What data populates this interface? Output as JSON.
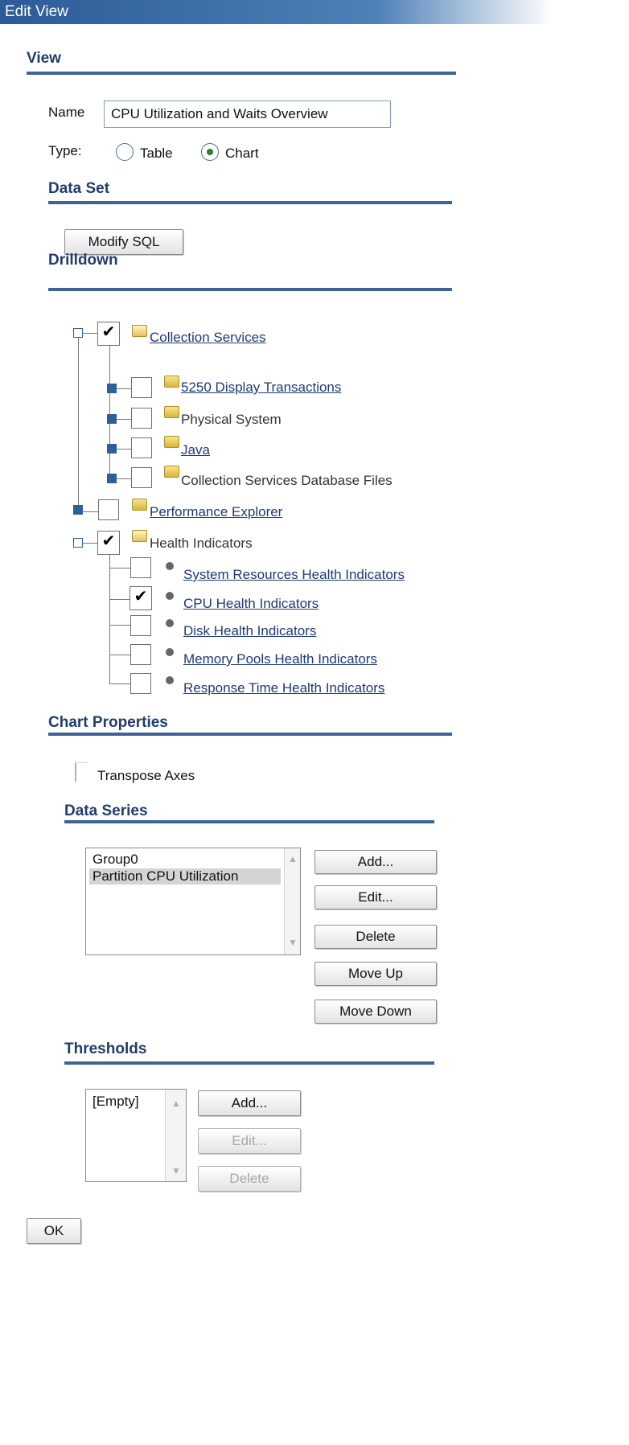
{
  "window": {
    "title": "Edit View"
  },
  "view": {
    "section_title": "View",
    "name_label": "Name",
    "name_value": "CPU Utilization and Waits Overview",
    "type_label": "Type:",
    "type_options": [
      {
        "label": "Table",
        "selected": false
      },
      {
        "label": "Chart",
        "selected": true
      }
    ]
  },
  "data_set": {
    "section_title": "Data Set",
    "modify_sql_label": "Modify SQL"
  },
  "drilldown": {
    "section_title": "Drilldown",
    "collection_services": {
      "label": "Collection Services",
      "checked": true
    },
    "cs_children": [
      {
        "label": "5250 Display Transactions",
        "checked": false
      },
      {
        "label": "Physical System",
        "checked": false
      },
      {
        "label": "Java",
        "checked": false
      },
      {
        "label": "Collection Services Database Files",
        "checked": false
      }
    ],
    "performance_explorer": {
      "label": "Performance Explorer",
      "checked": false
    },
    "health_indicators": {
      "label": "Health Indicators",
      "checked": true
    },
    "hi_children": [
      {
        "label": "System Resources Health Indicators",
        "checked": false
      },
      {
        "label": "CPU Health Indicators",
        "checked": true
      },
      {
        "label": "Disk Health Indicators",
        "checked": false
      },
      {
        "label": "Memory Pools Health Indicators",
        "checked": false
      },
      {
        "label": "Response Time Health Indicators",
        "checked": false
      }
    ]
  },
  "chart_properties": {
    "section_title": "Chart Properties",
    "transpose_label": "Transpose Axes",
    "transpose_checked": false
  },
  "data_series": {
    "section_title": "Data Series",
    "items": [
      "Group0",
      "Partition CPU Utilization"
    ],
    "selected_index": 1,
    "buttons": {
      "add": "Add...",
      "edit": "Edit...",
      "delete": "Delete",
      "move_up": "Move Up",
      "move_down": "Move Down"
    }
  },
  "thresholds": {
    "section_title": "Thresholds",
    "items": [
      "[Empty]"
    ],
    "buttons": {
      "add": "Add...",
      "edit": "Edit...",
      "delete": "Delete"
    }
  },
  "footer": {
    "ok_label": "OK"
  },
  "colors": {
    "accent": "#3c6499",
    "title_text": "#213d6b",
    "link": "#1f3a73"
  }
}
